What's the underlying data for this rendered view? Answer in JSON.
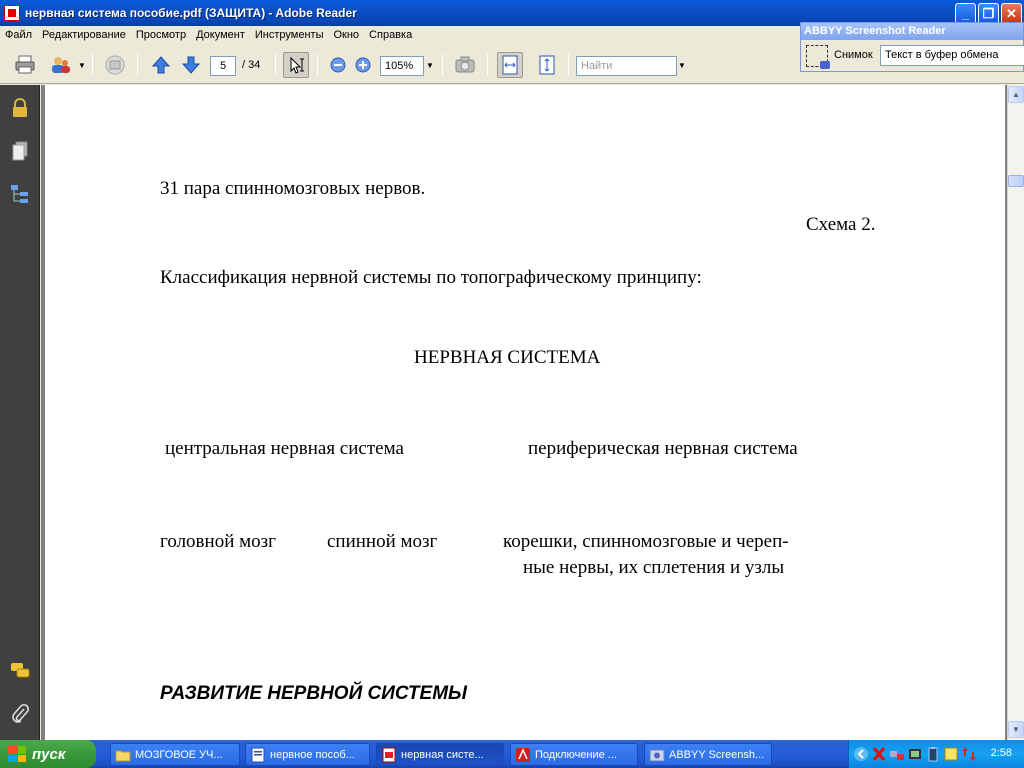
{
  "window": {
    "title": "нервная система  пособие.pdf (ЗАЩИТА) - Adobe Reader",
    "buttons": {
      "minimize": "_",
      "maximize": "❐",
      "close": "✕"
    }
  },
  "menu": [
    "Файл",
    "Редактирование",
    "Просмотр",
    "Документ",
    "Инструменты",
    "Окно",
    "Справка"
  ],
  "toolbar": {
    "page_current": "5",
    "page_total": "/ 34",
    "zoom": "105%",
    "find_placeholder": "Найти"
  },
  "abbyy": {
    "title": "ABBYY Screenshot Reader",
    "snap_label": "Снимок",
    "target": "Текст в буфер обмена"
  },
  "document": {
    "line1": "31 пара спинномозговых нервов.",
    "scheme": "Схема 2.",
    "classification": "Классификация нервной системы по топографическому принципу:",
    "root": "НЕРВНАЯ СИСТЕМА",
    "central": "центральная нервная система",
    "peripheral": "периферическая  нервная система",
    "brain": "головной мозг",
    "spinal": "спинной мозг",
    "roots_1": "корешки, спинномозговые и череп-",
    "roots_2": "ные  нервы,  их сплетения и узлы",
    "heading": "РАЗВИТИЕ НЕРВНОЙ СИСТЕМЫ"
  },
  "taskbar": {
    "start": "пуск",
    "tasks": [
      "МОЗГОВОЕ УЧ...",
      "нервное пособ...",
      "нервная систе...",
      "Подключение ...",
      "ABBYY Screensh..."
    ],
    "clock": "2:58"
  },
  "colors": {
    "titlebar": "#0846b6",
    "taskbar": "#245edb",
    "start": "#3a9a3a",
    "leftnav": "#404040"
  }
}
